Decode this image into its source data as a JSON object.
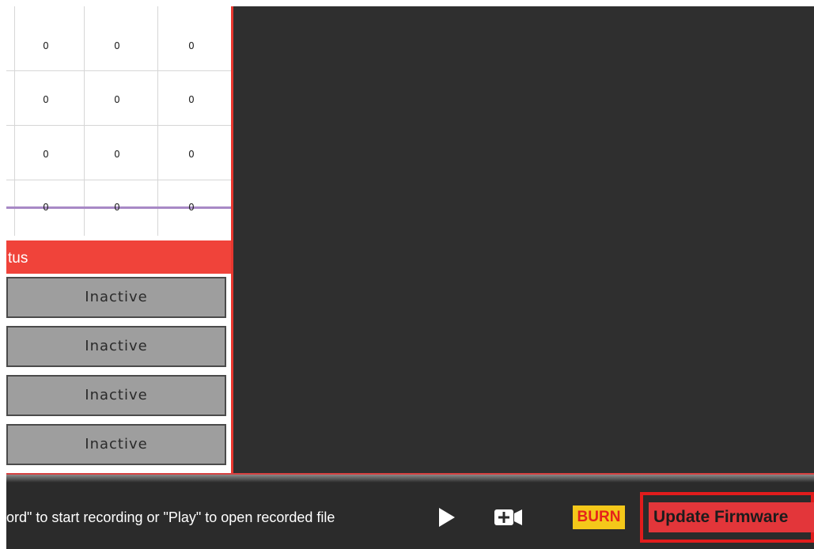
{
  "grid": {
    "rows": [
      [
        "0",
        "0",
        "0"
      ],
      [
        "0",
        "0",
        "0"
      ],
      [
        "0",
        "0",
        "0"
      ],
      [
        "0",
        "0",
        "0"
      ]
    ]
  },
  "status": {
    "header": "tus",
    "items": [
      "Inactive",
      "Inactive",
      "Inactive",
      "Inactive"
    ]
  },
  "bottom_bar": {
    "hint": "ord\" to start recording or \"Play\" to open recorded file",
    "burn_label": "BURN",
    "update_label": "Update Firmware",
    "play_icon": "play-icon",
    "camera_icon": "camera-add-icon"
  },
  "colors": {
    "accent_red": "#f0433a",
    "dark_panel": "#2f2f2f",
    "burn_bg": "#f4c81a",
    "burn_text": "#e5231b",
    "purple_line": "#a889c6"
  }
}
